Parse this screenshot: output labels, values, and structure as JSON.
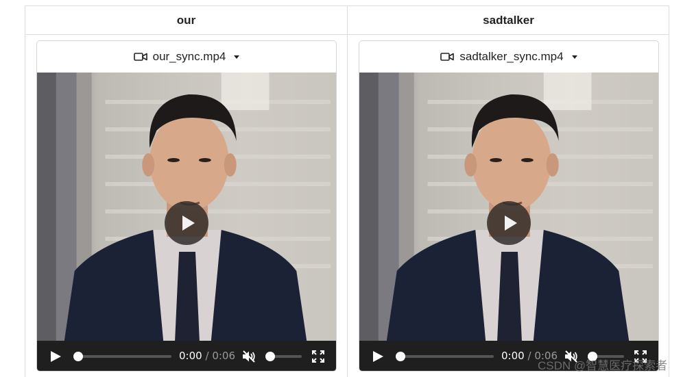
{
  "columns": [
    {
      "header": "our",
      "player": {
        "filename": "our_sync.mp4",
        "current_time": "0:00",
        "separator": "/",
        "duration": "0:06",
        "progress": 0.0,
        "volume": 0.0,
        "muted": true
      }
    },
    {
      "header": "sadtalker",
      "player": {
        "filename": "sadtalker_sync.mp4",
        "current_time": "0:00",
        "separator": "/",
        "duration": "0:06",
        "progress": 0.0,
        "volume": 0.0,
        "muted": true
      }
    }
  ],
  "icons": {
    "file_icon": "video-camera-icon",
    "dropdown_icon": "caret-down-icon",
    "big_play": "play-icon",
    "play": "play-icon",
    "mute": "volume-muted-icon",
    "fullscreen": "fullscreen-icon"
  },
  "watermark": "CSDN @智慧医疗探索者",
  "colors": {
    "controls_bg": "#1f1f1f",
    "border": "#dcdcdc"
  }
}
